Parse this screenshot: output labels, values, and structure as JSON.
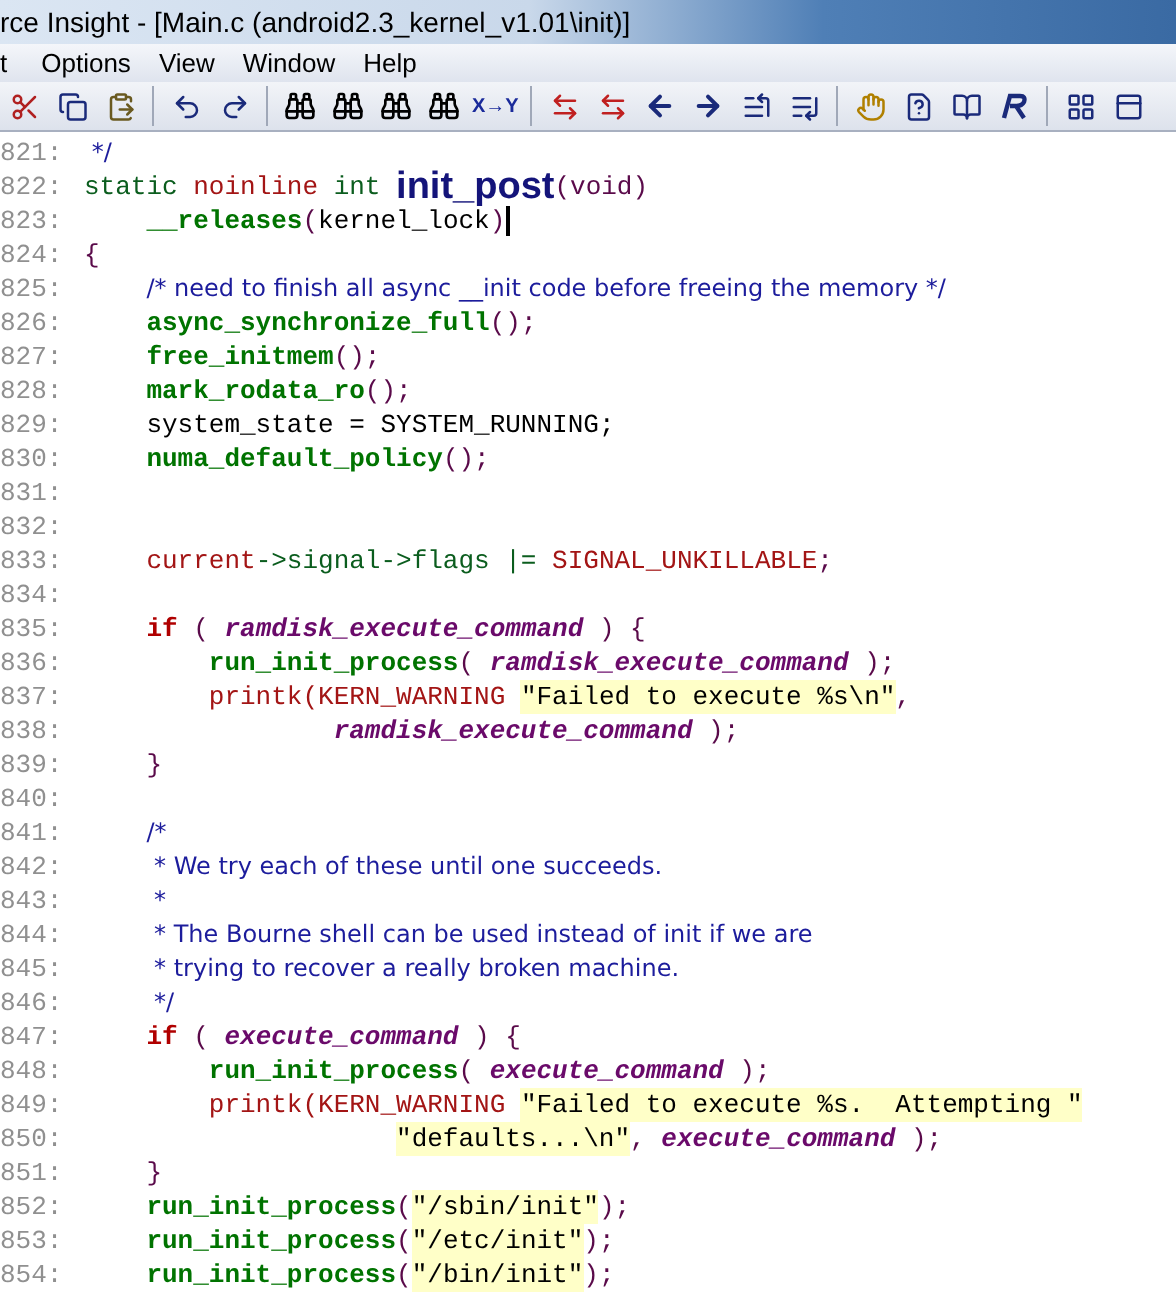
{
  "window": {
    "title": "rce Insight - [Main.c (android2.3_kernel_v1.01\\init)]"
  },
  "menu": [
    "t",
    "Options",
    "View",
    "Window",
    "Help"
  ],
  "toolbar": {
    "replace_label": "X→Y"
  },
  "editor": {
    "lines": [
      {
        "number": "821:",
        "caret": false,
        "tokens": [
          {
            "text": " */",
            "kind": "comment"
          }
        ]
      },
      {
        "number": "822:",
        "caret": false,
        "tokens": [
          {
            "text": "static ",
            "kind": "kw"
          },
          {
            "text": "noinline ",
            "kind": "storage"
          },
          {
            "text": "int ",
            "kind": "kw"
          },
          {
            "text": "init_post",
            "kind": "decl"
          },
          {
            "text": "(void)",
            "kind": "punct"
          }
        ]
      },
      {
        "number": "823:",
        "caret": true,
        "tokens": [
          {
            "kind": "indent_block"
          },
          {
            "text": "__releases",
            "kind": "fn"
          },
          {
            "text": "(",
            "kind": "punct"
          },
          {
            "text": "kernel_lock",
            "kind": "plain"
          },
          {
            "text": ")",
            "kind": "punct"
          }
        ]
      },
      {
        "number": "824:",
        "caret": false,
        "tokens": [
          {
            "text": "{",
            "kind": "punct"
          }
        ]
      },
      {
        "number": "825:",
        "caret": false,
        "tokens": [
          {
            "kind": "indent_block"
          },
          {
            "text": "/* need to finish all async __init code before freeing the memory */",
            "kind": "comment"
          }
        ]
      },
      {
        "number": "826:",
        "caret": false,
        "tokens": [
          {
            "kind": "indent_block"
          },
          {
            "text": "async_synchronize_full",
            "kind": "fn"
          },
          {
            "text": "();",
            "kind": "punct"
          }
        ]
      },
      {
        "number": "827:",
        "caret": false,
        "tokens": [
          {
            "kind": "indent_block"
          },
          {
            "text": "free_initmem",
            "kind": "fn"
          },
          {
            "text": "();",
            "kind": "punct"
          }
        ]
      },
      {
        "number": "828:",
        "caret": false,
        "tokens": [
          {
            "kind": "indent_block"
          },
          {
            "text": "mark_rodata_ro",
            "kind": "fn"
          },
          {
            "text": "();",
            "kind": "punct"
          }
        ]
      },
      {
        "number": "829:",
        "caret": false,
        "tokens": [
          {
            "kind": "indent_block"
          },
          {
            "text": "system_state = SYSTEM_RUNNING;",
            "kind": "plain"
          }
        ]
      },
      {
        "number": "830:",
        "caret": false,
        "tokens": [
          {
            "kind": "indent_block"
          },
          {
            "text": "numa_default_policy",
            "kind": "fn"
          },
          {
            "text": "();",
            "kind": "punct"
          }
        ]
      },
      {
        "number": "831:",
        "caret": false
      },
      {
        "number": "832:",
        "caret": false
      },
      {
        "number": "833:",
        "caret": false,
        "tokens": [
          {
            "kind": "indent_block"
          },
          {
            "text": "current",
            "kind": "macro"
          },
          {
            "text": "->signal->flags |= ",
            "kind": "kw"
          },
          {
            "text": "SIGNAL_UNKILLABLE",
            "kind": "macro"
          },
          {
            "text": ";",
            "kind": "punct"
          }
        ]
      },
      {
        "number": "834:",
        "caret": false
      },
      {
        "number": "835:",
        "caret": false,
        "tokens": [
          {
            "kind": "indent_block"
          },
          {
            "text": "if",
            "kind": "ctrl"
          },
          {
            "text": " ( ",
            "kind": "punct"
          },
          {
            "text": "ramdisk_execute_command",
            "kind": "var"
          },
          {
            "text": " ) {",
            "kind": "punct"
          }
        ]
      },
      {
        "number": "836:",
        "caret": false,
        "tokens": [
          {
            "kind": "indent_nested"
          },
          {
            "text": "run_init_process",
            "kind": "fn"
          },
          {
            "text": "( ",
            "kind": "punct"
          },
          {
            "text": "ramdisk_execute_command",
            "kind": "var"
          },
          {
            "text": " );",
            "kind": "punct"
          }
        ]
      },
      {
        "number": "837:",
        "caret": false,
        "tokens": [
          {
            "kind": "indent_nested"
          },
          {
            "text": "printk(KERN_WARNING ",
            "kind": "macro"
          },
          {
            "text": "\"Failed to execute %s\\n\"",
            "kind": "string"
          },
          {
            "text": ",",
            "kind": "punct"
          }
        ]
      },
      {
        "number": "838:",
        "caret": false,
        "tokens": [
          {
            "kind": "indent_wrapped"
          },
          {
            "text": "ramdisk_execute_command",
            "kind": "var"
          },
          {
            "text": " );",
            "kind": "punct"
          }
        ]
      },
      {
        "number": "839:",
        "caret": false,
        "tokens": [
          {
            "kind": "indent_block"
          },
          {
            "text": "}",
            "kind": "punct"
          }
        ]
      },
      {
        "number": "840:",
        "caret": false
      },
      {
        "number": "841:",
        "caret": false,
        "tokens": [
          {
            "kind": "indent_block"
          },
          {
            "text": "/*",
            "kind": "comment"
          }
        ]
      },
      {
        "number": "842:",
        "caret": false,
        "tokens": [
          {
            "kind": "indent_block"
          },
          {
            "text": " * We try each of these until one succeeds.",
            "kind": "comment"
          }
        ]
      },
      {
        "number": "843:",
        "caret": false,
        "tokens": [
          {
            "kind": "indent_block"
          },
          {
            "text": " *",
            "kind": "comment"
          }
        ]
      },
      {
        "number": "844:",
        "caret": false,
        "tokens": [
          {
            "kind": "indent_block"
          },
          {
            "text": " * The Bourne shell can be used instead of init if we are",
            "kind": "comment"
          }
        ]
      },
      {
        "number": "845:",
        "caret": false,
        "tokens": [
          {
            "kind": "indent_block"
          },
          {
            "text": " * trying to recover a really broken machine.",
            "kind": "comment"
          }
        ]
      },
      {
        "number": "846:",
        "caret": false,
        "tokens": [
          {
            "kind": "indent_block"
          },
          {
            "text": " */",
            "kind": "comment"
          }
        ]
      },
      {
        "number": "847:",
        "caret": false,
        "tokens": [
          {
            "kind": "indent_block"
          },
          {
            "text": "if",
            "kind": "ctrl"
          },
          {
            "text": " ( ",
            "kind": "punct"
          },
          {
            "text": "execute_command",
            "kind": "var"
          },
          {
            "text": " ) {",
            "kind": "punct"
          }
        ]
      },
      {
        "number": "848:",
        "caret": false,
        "tokens": [
          {
            "kind": "indent_nested"
          },
          {
            "text": "run_init_process",
            "kind": "fn"
          },
          {
            "text": "( ",
            "kind": "punct"
          },
          {
            "text": "execute_command",
            "kind": "var"
          },
          {
            "text": " );",
            "kind": "punct"
          }
        ]
      },
      {
        "number": "849:",
        "caret": false,
        "tokens": [
          {
            "kind": "indent_nested"
          },
          {
            "text": "printk(KERN_WARNING ",
            "kind": "macro"
          },
          {
            "text": "\"Failed to execute %s.  Attempting \"",
            "kind": "string"
          }
        ]
      },
      {
        "number": "850:",
        "caret": false,
        "tokens": [
          {
            "kind": "indent_wrapped_deep"
          },
          {
            "text": "\"defaults...\\n\"",
            "kind": "string"
          },
          {
            "text": ", ",
            "kind": "punct"
          },
          {
            "text": "execute_command",
            "kind": "var"
          },
          {
            "text": " );",
            "kind": "punct"
          }
        ]
      },
      {
        "number": "851:",
        "caret": false,
        "tokens": [
          {
            "kind": "indent_block"
          },
          {
            "text": "}",
            "kind": "punct"
          }
        ]
      },
      {
        "number": "852:",
        "caret": false,
        "tokens": [
          {
            "kind": "indent_block"
          },
          {
            "text": "run_init_process",
            "kind": "fn"
          },
          {
            "text": "(",
            "kind": "punct"
          },
          {
            "text": "\"/sbin/init\"",
            "kind": "string"
          },
          {
            "text": ");",
            "kind": "punct"
          }
        ]
      },
      {
        "number": "853:",
        "caret": false,
        "tokens": [
          {
            "kind": "indent_block"
          },
          {
            "text": "run_init_process",
            "kind": "fn"
          },
          {
            "text": "(",
            "kind": "punct"
          },
          {
            "text": "\"/etc/init\"",
            "kind": "string"
          },
          {
            "text": ");",
            "kind": "punct"
          }
        ]
      },
      {
        "number": "854:",
        "caret": false,
        "tokens": [
          {
            "kind": "indent_block"
          },
          {
            "text": "run_init_process",
            "kind": "fn"
          },
          {
            "text": "(",
            "kind": "punct"
          },
          {
            "text": "\"/bin/init\"",
            "kind": "string"
          },
          {
            "text": ");",
            "kind": "punct"
          }
        ]
      }
    ]
  }
}
